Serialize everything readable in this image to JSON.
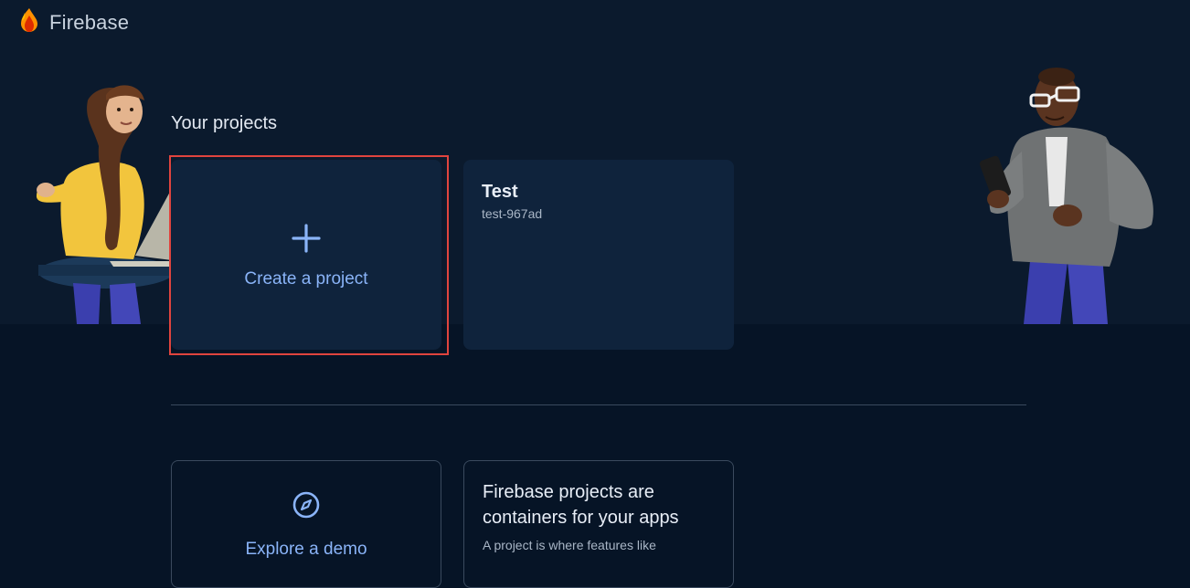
{
  "app": {
    "brand_name": "Firebase"
  },
  "projects_section": {
    "title": "Your projects",
    "create_label": "Create a project",
    "projects": [
      {
        "name": "Test",
        "id": "test-967ad"
      }
    ]
  },
  "explore_section": {
    "demo_label": "Explore a demo",
    "info_title_line1": "Firebase projects are",
    "info_title_line2": "containers for your apps",
    "info_desc": "A project is where features like"
  },
  "icons": {
    "logo": "firebase-flame-icon",
    "create": "plus-icon",
    "demo": "compass-icon"
  },
  "colors": {
    "background": "#061426",
    "hero_band": "#0b1a2d",
    "card": "#0f233c",
    "accent_blue": "#8ab4f8",
    "highlight_red": "#e0443e"
  }
}
